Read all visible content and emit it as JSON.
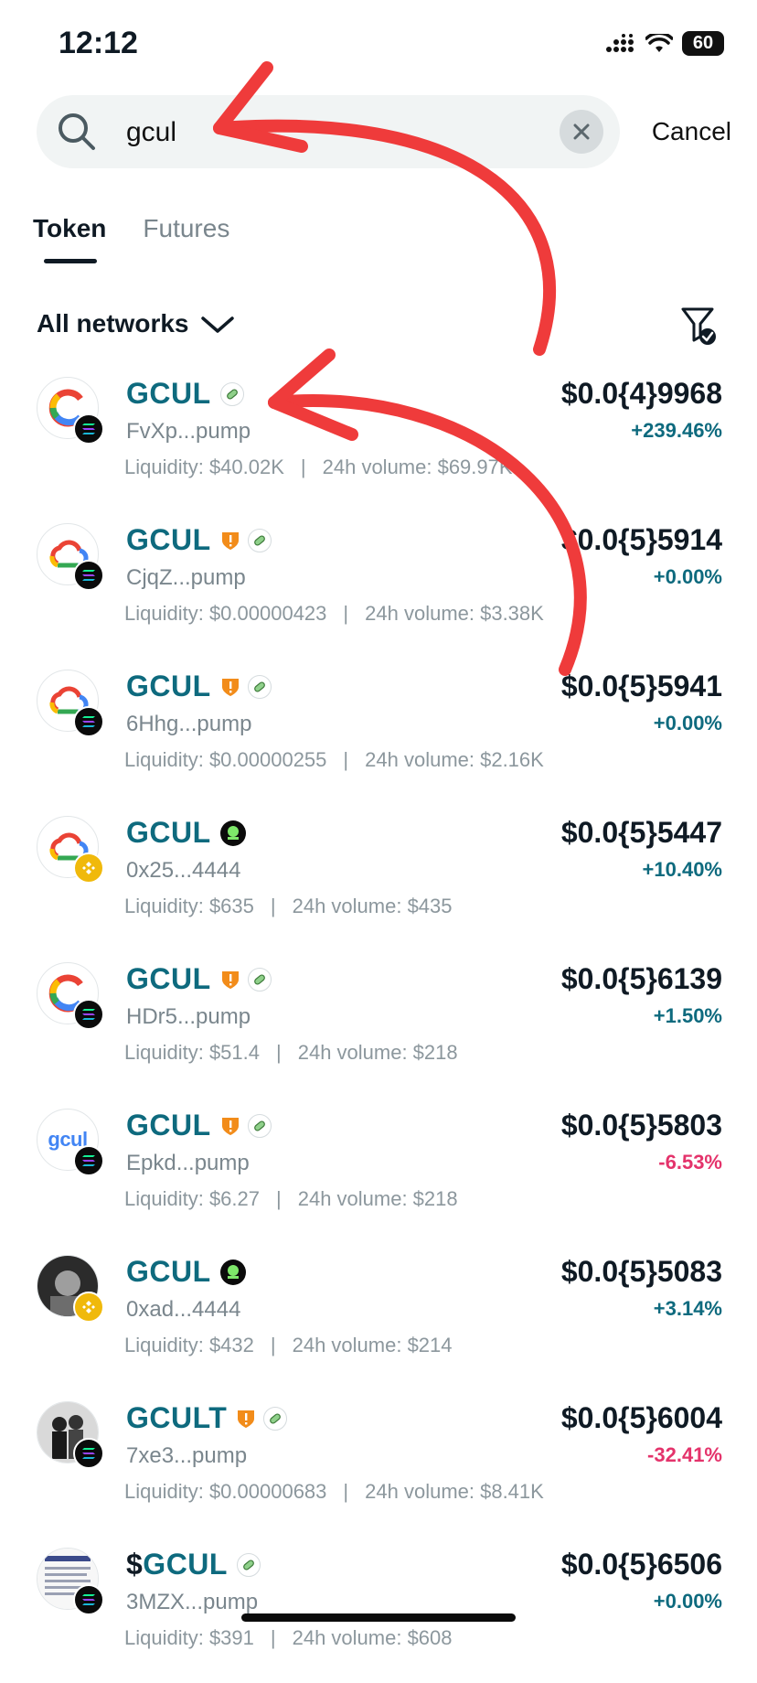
{
  "status_bar": {
    "time": "12:12",
    "battery": "60"
  },
  "search": {
    "value": "gcul",
    "cancel_label": "Cancel"
  },
  "tabs": [
    {
      "label": "Token"
    },
    {
      "label": "Futures"
    }
  ],
  "network_filter": {
    "label": "All networks"
  },
  "colors": {
    "accent": "#0e6a7e",
    "positive": "#0e6a7e",
    "negative": "#e4336b",
    "annotation": "#ef3b3b"
  },
  "tokens": [
    {
      "prefix": "",
      "name": "GCUL",
      "address": "FvXp...pump",
      "liquidity": "Liquidity: $40.02K",
      "volume": "24h volume: $69.97K",
      "price": "$0.0{4}9968",
      "change": "+239.46%",
      "change_dir": "up",
      "badges": [
        "pill"
      ],
      "chain": "solana",
      "logo": "google-c"
    },
    {
      "prefix": "",
      "name": "GCUL",
      "address": "CjqZ...pump",
      "liquidity": "Liquidity: $0.00000423",
      "volume": "24h volume: $3.38K",
      "price": "$0.0{5}5914",
      "change": "+0.00%",
      "change_dir": "up",
      "badges": [
        "shield",
        "pill"
      ],
      "chain": "solana",
      "logo": "google-cloud"
    },
    {
      "prefix": "",
      "name": "GCUL",
      "address": "6Hhg...pump",
      "liquidity": "Liquidity: $0.00000255",
      "volume": "24h volume: $2.16K",
      "price": "$0.0{5}5941",
      "change": "+0.00%",
      "change_dir": "up",
      "badges": [
        "shield",
        "pill"
      ],
      "chain": "solana",
      "logo": "google-cloud"
    },
    {
      "prefix": "",
      "name": "GCUL",
      "address": "0x25...4444",
      "liquidity": "Liquidity: $635",
      "volume": "24h volume: $435",
      "price": "$0.0{5}5447",
      "change": "+10.40%",
      "change_dir": "up",
      "badges": [
        "four"
      ],
      "chain": "bnb",
      "logo": "google-cloud"
    },
    {
      "prefix": "",
      "name": "GCUL",
      "address": "HDr5...pump",
      "liquidity": "Liquidity: $51.4",
      "volume": "24h volume: $218",
      "price": "$0.0{5}6139",
      "change": "+1.50%",
      "change_dir": "up",
      "badges": [
        "shield",
        "pill"
      ],
      "chain": "solana",
      "logo": "google-c"
    },
    {
      "prefix": "",
      "name": "GCUL",
      "address": "Epkd...pump",
      "liquidity": "Liquidity: $6.27",
      "volume": "24h volume: $218",
      "price": "$0.0{5}5803",
      "change": "-6.53%",
      "change_dir": "down",
      "badges": [
        "shield",
        "pill"
      ],
      "chain": "solana",
      "logo": "gcul-text",
      "logo_text": "gcul"
    },
    {
      "prefix": "",
      "name": "GCUL",
      "address": "0xad...4444",
      "liquidity": "Liquidity: $432",
      "volume": "24h volume: $214",
      "price": "$0.0{5}5083",
      "change": "+3.14%",
      "change_dir": "up",
      "badges": [
        "four"
      ],
      "chain": "bnb",
      "logo": "photo-dark"
    },
    {
      "prefix": "",
      "name": "GCULT",
      "address": "7xe3...pump",
      "liquidity": "Liquidity: $0.00000683",
      "volume": "24h volume: $8.41K",
      "price": "$0.0{5}6004",
      "change": "-32.41%",
      "change_dir": "down",
      "badges": [
        "shield",
        "pill"
      ],
      "chain": "solana",
      "logo": "photo-people"
    },
    {
      "prefix": "$",
      "name": "GCUL",
      "address": "3MZX...pump",
      "liquidity": "Liquidity: $391",
      "volume": "24h volume: $608",
      "price": "$0.0{5}6506",
      "change": "+0.00%",
      "change_dir": "up",
      "badges": [
        "pill"
      ],
      "chain": "solana",
      "logo": "document"
    }
  ]
}
